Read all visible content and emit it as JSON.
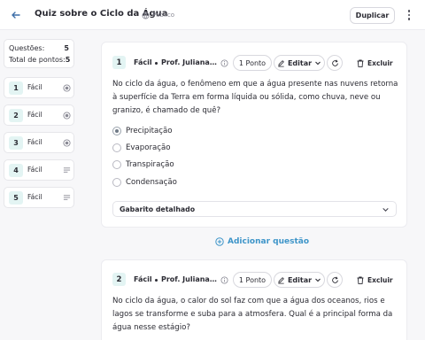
{
  "header": {
    "title": "Quiz sobre o Ciclo da Água",
    "visibility": "Público",
    "duplicate_label": "Duplicar"
  },
  "sidebar": {
    "questions_label": "Questões:",
    "questions_count": "5",
    "points_label": "Total de pontos:",
    "points_count": "5",
    "items": [
      {
        "num": "1",
        "level": "Fácil",
        "icon": "radio-icon"
      },
      {
        "num": "2",
        "level": "Fácil",
        "icon": "radio-icon"
      },
      {
        "num": "3",
        "level": "Fácil",
        "icon": "radio-icon"
      },
      {
        "num": "4",
        "level": "Fácil",
        "icon": "lines-icon"
      },
      {
        "num": "5",
        "level": "Fácil",
        "icon": "lines-icon"
      }
    ]
  },
  "questions": [
    {
      "num": "1",
      "level": "Fácil",
      "author": "Prof. Juliana Li...",
      "points": "1 Ponto",
      "edit_label": "Editar",
      "delete_label": "Excluir",
      "text": "No ciclo da água, o fenômeno em que a água presente nas nuvens retorna à superfície da Terra em forma líquida ou sólida, como chuva, neve ou granizo, é chamado de quê?",
      "options": [
        "Precipitação",
        "Evaporação",
        "Transpiração",
        "Condensação"
      ],
      "selected_option": 0,
      "answer_toggle": "Gabarito detalhado"
    },
    {
      "num": "2",
      "level": "Fácil",
      "author": "Prof. Juliana Li...",
      "points": "1 Ponto",
      "edit_label": "Editar",
      "delete_label": "Excluir",
      "text": "No ciclo da água, o calor do sol faz com que a água dos oceanos, rios e lagos se transforme e suba para a atmosfera. Qual é a principal forma da água nesse estágio?"
    }
  ],
  "add_question_label": "Adicionar questão",
  "colors": {
    "accent": "#3e95c9",
    "number_badge": "#e3f4f3",
    "background": "#f7f7f9"
  }
}
